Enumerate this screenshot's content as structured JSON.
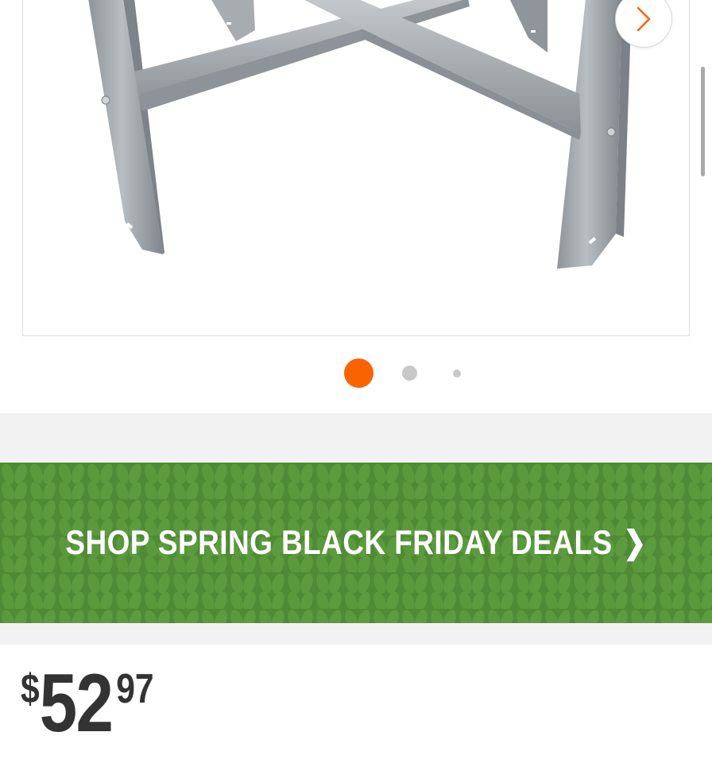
{
  "gallery": {
    "image": {
      "alt_icon": "metal-workbench-legs-image"
    },
    "next_button_icon": "chevron-right-icon",
    "page_indicator": {
      "active_index": 0,
      "count": 3
    },
    "accent_color": "#f96302"
  },
  "promo_banner": {
    "label": "SHOP SPRING BLACK FRIDAY DEALS",
    "chevron": "❯",
    "background_color": "#4f8a34"
  },
  "price": {
    "currency": "$",
    "dollars": "52",
    "cents": "97",
    "text_color": "#333333"
  }
}
